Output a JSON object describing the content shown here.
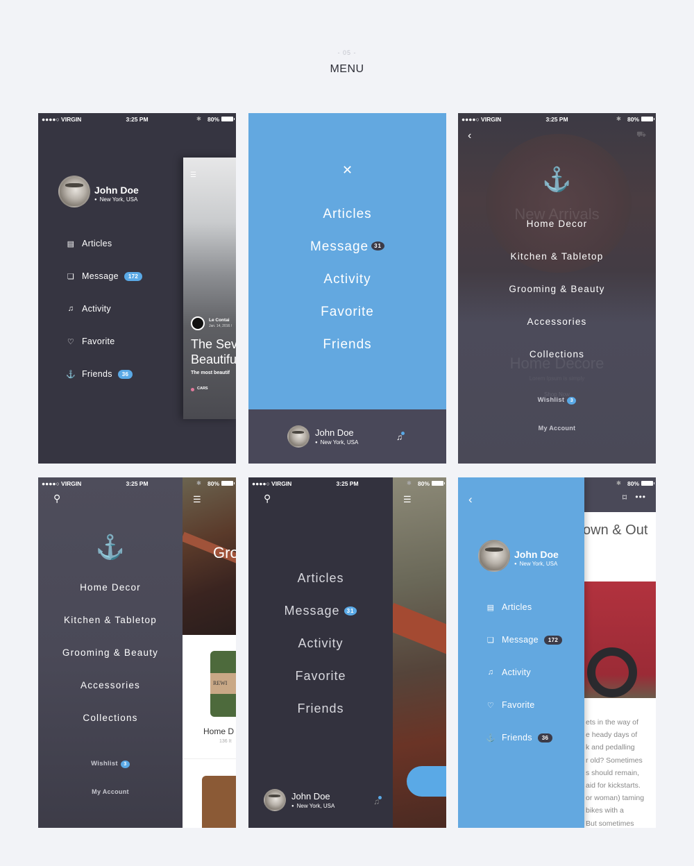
{
  "header": {
    "number": "- 05 -",
    "title": "MENU"
  },
  "status_bar": {
    "carrier": "●●●●○ VIRGIN",
    "time": "3:25 PM",
    "battery": "80%"
  },
  "user": {
    "name": "John Doe",
    "location": "New York, USA"
  },
  "menu_items": [
    {
      "label": "Articles",
      "icon": "articles-icon"
    },
    {
      "label": "Message",
      "icon": "message-icon"
    },
    {
      "label": "Activity",
      "icon": "bell-icon"
    },
    {
      "label": "Favorite",
      "icon": "heart-icon"
    },
    {
      "label": "Friends",
      "icon": "anchor-icon"
    }
  ],
  "badges": {
    "message_large": "172",
    "friends": "36",
    "message_small": "31",
    "wishlist": "3"
  },
  "categories": [
    "Home Decor",
    "Kitchen & Tabletop",
    "Grooming & Beauty",
    "Accessories",
    "Collections"
  ],
  "links": {
    "wishlist": "Wishlist",
    "my_account": "My Account"
  },
  "screen1_peek": {
    "source": "Le Contai",
    "date": "Jan. 14, 2016 /",
    "title_line1": "The Sev",
    "title_line2": "Beautifu",
    "subtitle": "The most beautif",
    "tag": "CARS"
  },
  "screen3_bg": {
    "banner1": "New Arrivals",
    "banner2": "Home Decore",
    "banner2_sub": "Lorem Ipsum is simply",
    "shop_now": "Shop Now"
  },
  "screen4_peek": {
    "hero_text": "Gro",
    "product_name": "Home D",
    "product_count": "136 It",
    "label": "REWI"
  },
  "screen6_peek": {
    "title": "own & Out",
    "body": [
      "ets in the way of",
      "e heady days of",
      "k and pedalling",
      "r old? Sometimes",
      "s should remain,",
      "aid for kickstarts.",
      "or woman) taming",
      "bikes with a",
      "But sometimes"
    ]
  },
  "colors": {
    "blue": "#63a8e0",
    "dark": "#363541",
    "badge_blue": "#5aa9e6"
  }
}
